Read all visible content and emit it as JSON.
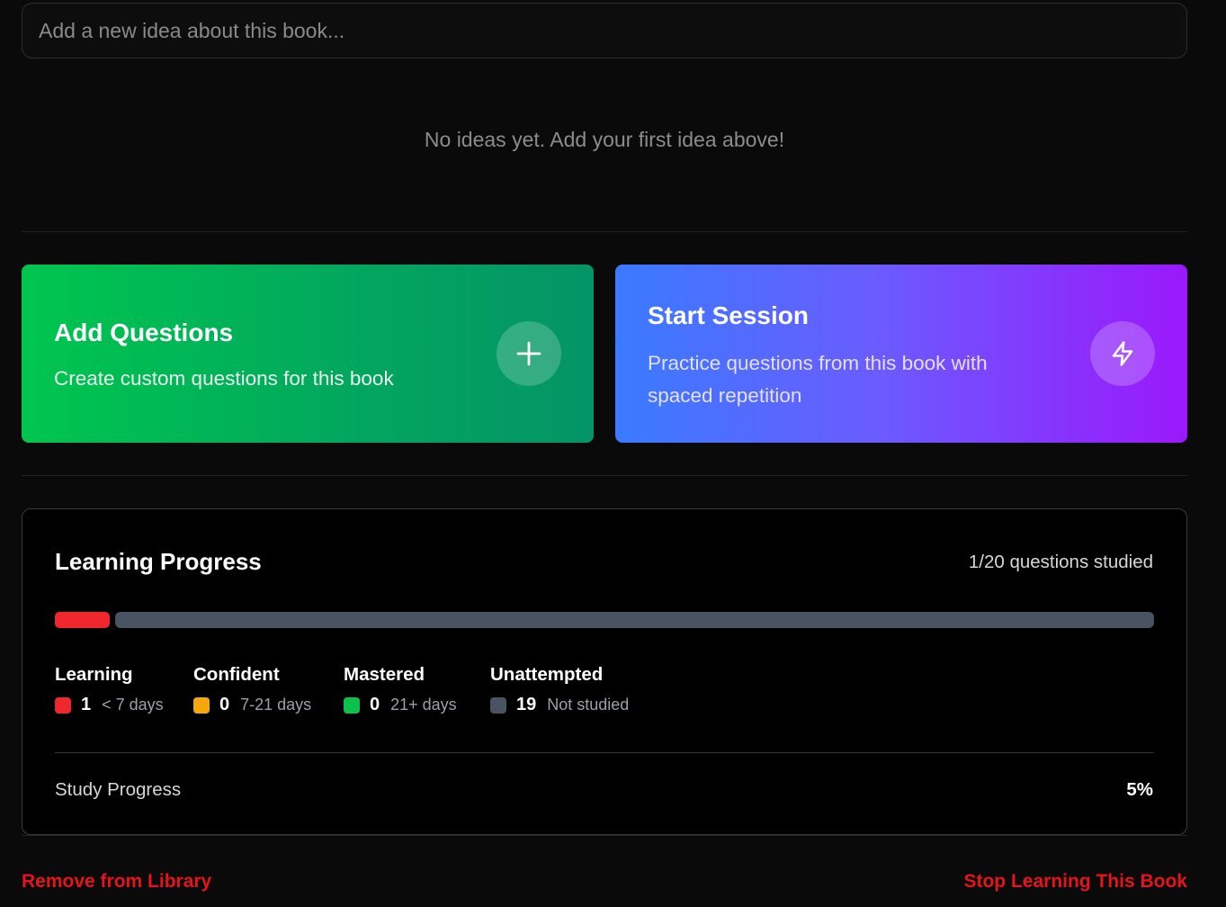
{
  "idea_input": {
    "placeholder": "Add a new idea about this book...",
    "value": ""
  },
  "ideas": {
    "empty_message": "No ideas yet. Add your first idea above!"
  },
  "actions": {
    "add_questions": {
      "title": "Add Questions",
      "description": "Create custom questions for this book",
      "icon": "plus-icon",
      "gradient": [
        "#00c64e",
        "#049466"
      ]
    },
    "start_session": {
      "title": "Start Session",
      "description": "Practice questions from this book with spaced repetition",
      "icon": "lightning-icon",
      "gradient": [
        "#3a7bff",
        "#9b18fb"
      ]
    }
  },
  "progress": {
    "title": "Learning Progress",
    "questions_studied_text": "1/20 questions studied",
    "studied": 1,
    "total": 20,
    "categories": [
      {
        "label": "Learning",
        "count": "1",
        "desc": "< 7 days",
        "color": "#f0262d"
      },
      {
        "label": "Confident",
        "count": "0",
        "desc": "7-21 days",
        "color": "#f5a70d"
      },
      {
        "label": "Mastered",
        "count": "0",
        "desc": "21+ days",
        "color": "#0cc24c"
      },
      {
        "label": "Unattempted",
        "count": "19",
        "desc": "Not studied",
        "color": "#4a5361"
      }
    ],
    "study_progress_label": "Study Progress",
    "study_progress_value": "5%"
  },
  "footer": {
    "remove_label": "Remove from Library",
    "stop_label": "Stop Learning This Book",
    "danger_color": "#e5141c"
  }
}
